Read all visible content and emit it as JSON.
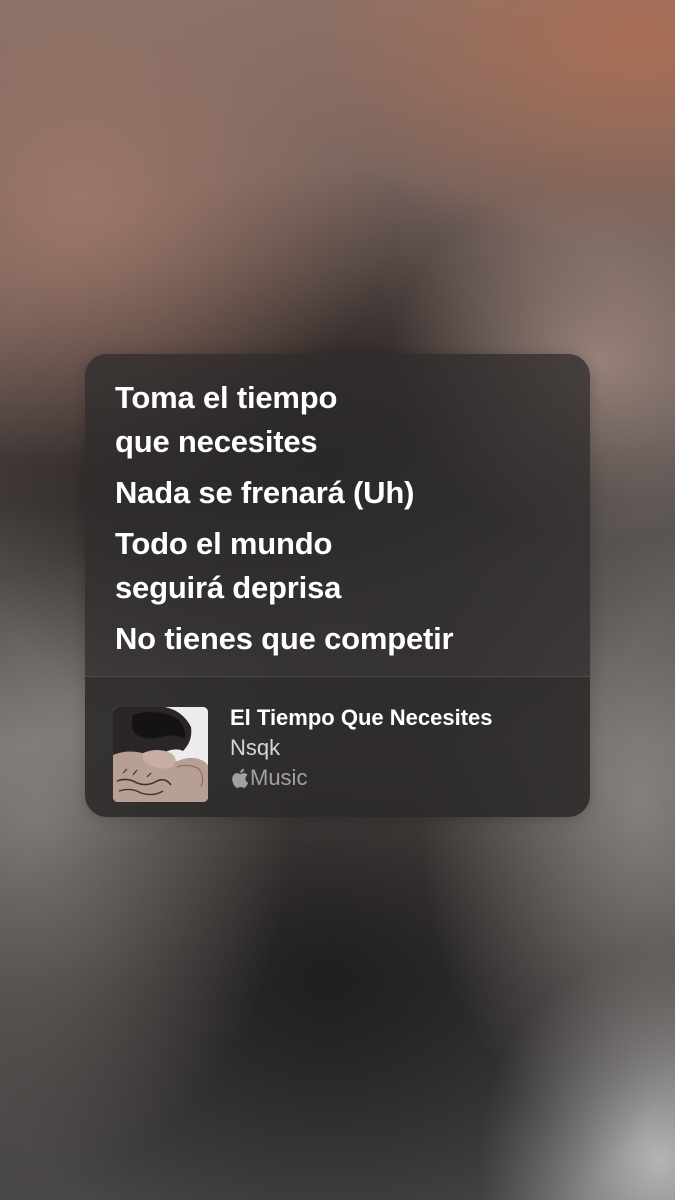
{
  "lyrics": {
    "lines": [
      "Toma el tiempo",
      "que necesites",
      "Nada se frenará (Uh)",
      "Todo el mundo",
      "seguirá deprisa",
      "No tienes que competir"
    ]
  },
  "track": {
    "title": "El Tiempo Que Necesites",
    "artist": "Nsqk",
    "service_label": "Music",
    "service_icon": "apple-logo-icon",
    "artwork_icon": "album-artwork"
  }
}
